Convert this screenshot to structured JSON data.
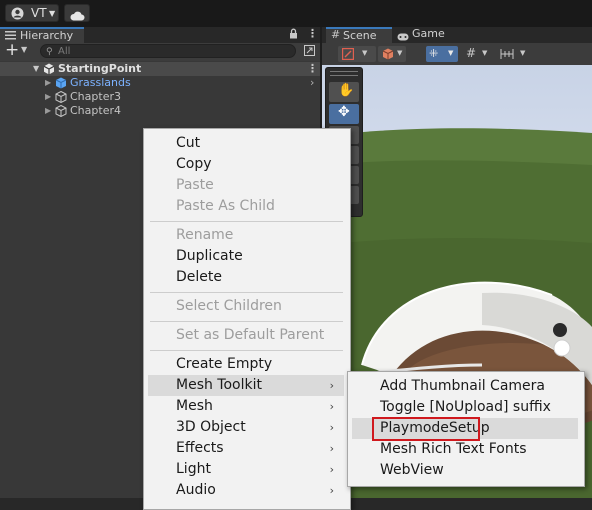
{
  "toolbar": {
    "account_label": "VT",
    "account_icon": "user-circle-icon",
    "cloud_icon": "cloud-icon"
  },
  "hierarchy": {
    "tab_label": "Hierarchy",
    "search_placeholder": "All",
    "root": {
      "label": "StartingPoint"
    },
    "children": [
      {
        "label": "Grasslands",
        "color": "#7cb2ff"
      },
      {
        "label": "Chapter3",
        "color": "#c4c4c4"
      },
      {
        "label": "Chapter4",
        "color": "#c4c4c4"
      }
    ]
  },
  "scene": {
    "tab_scene": "Scene",
    "tab_game": "Game"
  },
  "context_menu": {
    "items": [
      {
        "label": "Cut",
        "disabled": false
      },
      {
        "label": "Copy",
        "disabled": false
      },
      {
        "label": "Paste",
        "disabled": true
      },
      {
        "label": "Paste As Child",
        "disabled": true
      },
      {
        "label": "Rename",
        "disabled": true
      },
      {
        "label": "Duplicate",
        "disabled": false
      },
      {
        "label": "Delete",
        "disabled": false
      },
      {
        "label": "Select Children",
        "disabled": true
      },
      {
        "label": "Set as Default Parent",
        "disabled": true
      },
      {
        "label": "Create Empty",
        "disabled": false
      },
      {
        "label": "Mesh Toolkit",
        "disabled": false,
        "submenu": true,
        "highlighted": true
      },
      {
        "label": "Mesh",
        "disabled": false,
        "submenu": true
      },
      {
        "label": "3D Object",
        "disabled": false,
        "submenu": true
      },
      {
        "label": "Effects",
        "disabled": false,
        "submenu": true
      },
      {
        "label": "Light",
        "disabled": false,
        "submenu": true
      },
      {
        "label": "Audio",
        "disabled": false,
        "submenu": true
      }
    ]
  },
  "submenu": {
    "items": [
      {
        "label": "Add Thumbnail Camera"
      },
      {
        "label": "Toggle [NoUpload] suffix"
      },
      {
        "label": "PlaymodeSetup",
        "highlighted": true,
        "outlined": true
      },
      {
        "label": "Mesh Rich Text Fonts"
      },
      {
        "label": "WebView"
      }
    ],
    "outline_color": "#d0191e"
  },
  "colors": {
    "selection_blue": "#3a79bb",
    "panel_bg": "#383838",
    "menu_bg": "#f2f2f2"
  }
}
